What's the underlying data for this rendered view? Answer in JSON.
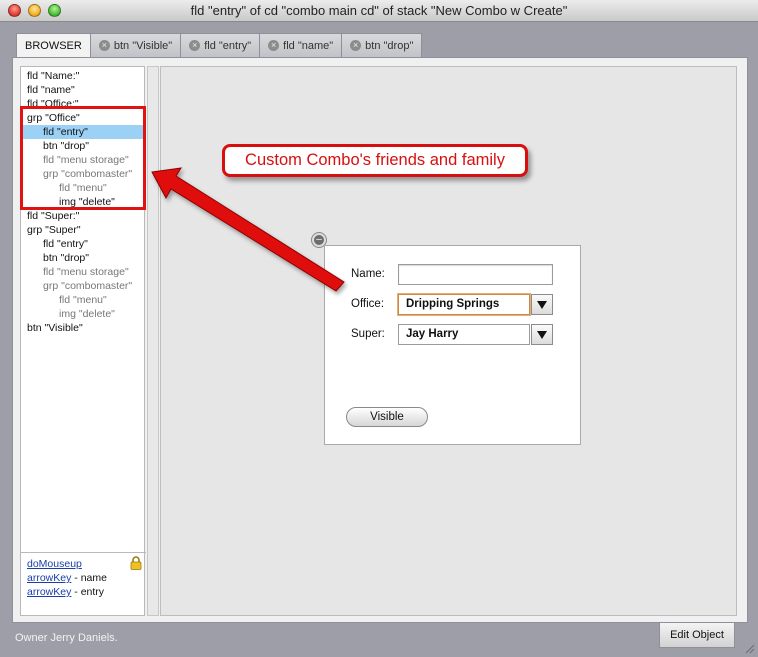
{
  "window": {
    "title": "fld \"entry\" of cd \"combo main cd\" of stack \"New Combo w Create\""
  },
  "tabs": [
    {
      "label": "BROWSER",
      "closable": false,
      "active": true
    },
    {
      "label": "btn \"Visible\"",
      "closable": true,
      "active": false
    },
    {
      "label": "fld \"entry\"",
      "closable": true,
      "active": false
    },
    {
      "label": "fld \"name\"",
      "closable": true,
      "active": false
    },
    {
      "label": "btn \"drop\"",
      "closable": true,
      "active": false
    }
  ],
  "tree": [
    {
      "label": "fld \"Name:\"",
      "indent": 0,
      "dim": false
    },
    {
      "label": "fld \"name\"",
      "indent": 0,
      "dim": false
    },
    {
      "label": "fld \"Office:\"",
      "indent": 0,
      "dim": false
    },
    {
      "label": "grp \"Office\"",
      "indent": 0,
      "dim": false
    },
    {
      "label": "fld \"entry\"",
      "indent": 1,
      "dim": false,
      "selected": true
    },
    {
      "label": "btn \"drop\"",
      "indent": 1,
      "dim": false
    },
    {
      "label": "fld \"menu storage\"",
      "indent": 1,
      "dim": true
    },
    {
      "label": "grp \"combomaster\"",
      "indent": 1,
      "dim": true
    },
    {
      "label": "fld \"menu\"",
      "indent": 2,
      "dim": true
    },
    {
      "label": "img \"delete\"",
      "indent": 2,
      "dim": false
    },
    {
      "label": "fld \"Super:\"",
      "indent": 0,
      "dim": false
    },
    {
      "label": "grp \"Super\"",
      "indent": 0,
      "dim": false
    },
    {
      "label": "fld \"entry\"",
      "indent": 1,
      "dim": false
    },
    {
      "label": "btn \"drop\"",
      "indent": 1,
      "dim": false
    },
    {
      "label": "fld \"menu storage\"",
      "indent": 1,
      "dim": true
    },
    {
      "label": "grp \"combomaster\"",
      "indent": 1,
      "dim": true
    },
    {
      "label": "fld \"menu\"",
      "indent": 2,
      "dim": true
    },
    {
      "label": "img \"delete\"",
      "indent": 2,
      "dim": true
    },
    {
      "label": "btn \"Visible\"",
      "indent": 0,
      "dim": false
    }
  ],
  "handlers": [
    {
      "name": "doMouseup",
      "target": ""
    },
    {
      "name": "arrowKey",
      "target": " - name"
    },
    {
      "name": "arrowKey",
      "target": " - entry"
    }
  ],
  "form": {
    "name_label": "Name:",
    "name_value": "",
    "office_label": "Office:",
    "office_value": "Dripping Springs",
    "super_label": "Super:",
    "super_value": "Jay Harry",
    "visible_button": "Visible"
  },
  "annotation": {
    "callout_text": "Custom Combo's friends and family",
    "color": "#d80f0f"
  },
  "footer": {
    "owner_text": "Owner Jerry Daniels.",
    "edit_button": "Edit Object"
  },
  "icons": {
    "card_handle": "minus-circle-icon",
    "lock": "lock-icon",
    "tab_close": "close-circle-icon"
  }
}
